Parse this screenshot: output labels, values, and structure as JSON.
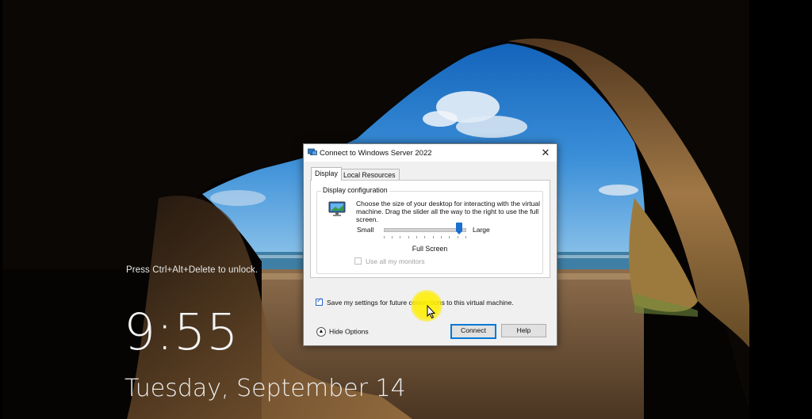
{
  "lockscreen": {
    "hint": "Press Ctrl+Alt+Delete to unlock.",
    "time": "9:55",
    "date": "Tuesday, September 14"
  },
  "dialog": {
    "title": "Connect to Windows Server 2022",
    "close_glyph": "✕",
    "tabs": [
      {
        "label": "Display",
        "active": true
      },
      {
        "label": "Local Resources",
        "active": false
      }
    ],
    "display": {
      "group_label": "Display configuration",
      "description": "Choose the size of your desktop for interacting with the virtual machine. Drag the slider all the way to the right to use the full screen.",
      "slider_min_label": "Small",
      "slider_max_label": "Large",
      "slider_value_text": "Full Screen",
      "slider_level": 1.0,
      "use_all_monitors_label": "Use all my monitors",
      "use_all_monitors_checked": false,
      "use_all_monitors_enabled": false
    },
    "save_settings_label": "Save my settings for future connections to this virtual machine.",
    "save_settings_checked": true,
    "hide_options_label": "Hide Options",
    "hide_options_glyph": "▲",
    "connect_label": "Connect",
    "help_label": "Help"
  },
  "icons": {
    "app": "remote-desktop-icon",
    "monitor": "monitor-icon",
    "close": "close-icon",
    "cursor": "mouse-cursor-icon"
  },
  "colors": {
    "accent": "#0078d7",
    "slider_thumb": "#1a6fd0",
    "cursor_highlight": "#fff200"
  }
}
